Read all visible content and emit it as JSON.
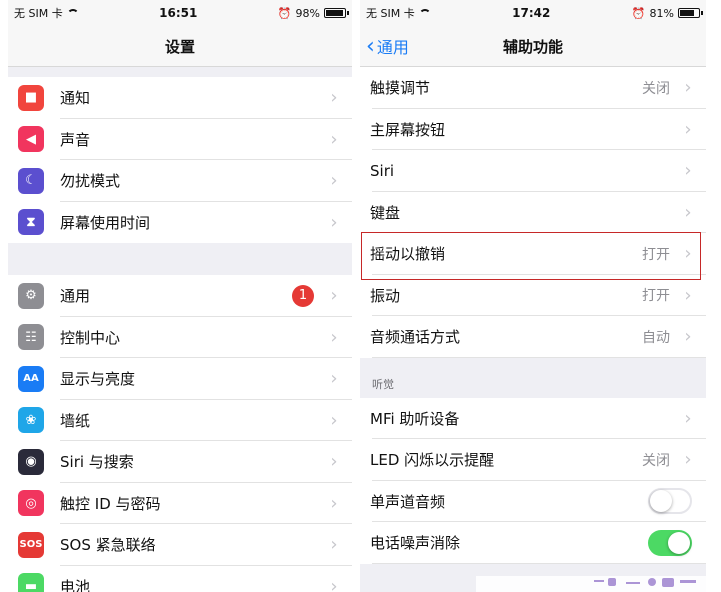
{
  "left": {
    "status": {
      "carrier": "无 SIM 卡",
      "time": "16:51",
      "battery": "98%",
      "battery_level": 0.98
    },
    "title": "设置",
    "groups": [
      [
        {
          "label": "通知",
          "icon": "notifications-icon",
          "color": "#f1453d",
          "glyph": "■"
        },
        {
          "label": "声音",
          "icon": "sound-icon",
          "color": "#f1355e",
          "glyph": "◀"
        },
        {
          "label": "勿扰模式",
          "icon": "moon-icon",
          "color": "#5b4fcf",
          "glyph": "☾"
        },
        {
          "label": "屏幕使用时间",
          "icon": "hourglass-icon",
          "color": "#5b4fcf",
          "glyph": "⧗"
        }
      ],
      [
        {
          "label": "通用",
          "icon": "gear-icon",
          "color": "#8e8e93",
          "glyph": "⚙",
          "badge": "1"
        },
        {
          "label": "控制中心",
          "icon": "control-center-icon",
          "color": "#8e8e93",
          "glyph": "☷"
        },
        {
          "label": "显示与亮度",
          "icon": "display-icon",
          "color": "#1a7cf5",
          "glyph": "AA"
        },
        {
          "label": "墙纸",
          "icon": "wallpaper-icon",
          "color": "#1fa6e8",
          "glyph": "❀"
        },
        {
          "label": "Siri 与搜索",
          "icon": "siri-icon",
          "color": "#2a2a3a",
          "glyph": "◉"
        },
        {
          "label": "触控 ID 与密码",
          "icon": "fingerprint-icon",
          "color": "#f1355e",
          "glyph": "◎"
        },
        {
          "label": "SOS 紧急联络",
          "icon": "sos-icon",
          "color": "#e53935",
          "glyph": "SOS"
        },
        {
          "label": "电池",
          "icon": "battery-icon",
          "color": "#4cd964",
          "glyph": "▬"
        }
      ]
    ]
  },
  "right": {
    "status": {
      "carrier": "无 SIM 卡",
      "time": "17:42",
      "battery": "81%",
      "battery_level": 0.81
    },
    "back": "通用",
    "title": "辅助功能",
    "rows": [
      {
        "label": "触摸调节",
        "value": "关闭"
      },
      {
        "label": "主屏幕按钮",
        "value": ""
      },
      {
        "label": "Siri",
        "value": ""
      },
      {
        "label": "键盘",
        "value": ""
      },
      {
        "label": "摇动以撤销",
        "value": "打开"
      },
      {
        "label": "振动",
        "value": "打开"
      },
      {
        "label": "音频通话方式",
        "value": "自动"
      }
    ],
    "section": "听觉",
    "rows2": [
      {
        "label": "MFi 助听设备",
        "value": ""
      },
      {
        "label": "LED 闪烁以示提醒",
        "value": "关闭"
      }
    ],
    "toggles": [
      {
        "label": "单声道音频",
        "on": false
      },
      {
        "label": "电话噪声消除",
        "on": true
      }
    ]
  }
}
